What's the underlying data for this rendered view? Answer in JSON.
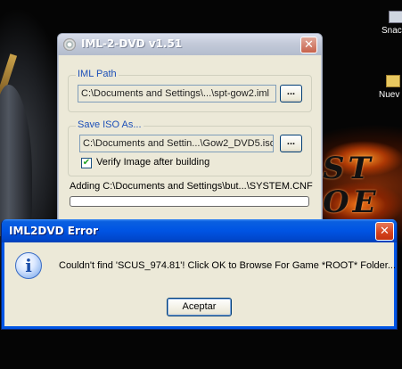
{
  "desktop": {
    "icons": [
      {
        "label": "Snac",
        "icon": "shortcut-icon"
      },
      {
        "label": "Nuev",
        "icon": "folder-icon"
      }
    ],
    "wallpaper_logo": "ST\nOE"
  },
  "main_window": {
    "title": "IML-2-DVD v1.51",
    "iml_group": {
      "legend": "IML Path",
      "path_value": "C:\\Documents and Settings\\...\\spt-gow2.iml",
      "browse_label": "..."
    },
    "iso_group": {
      "legend": "Save ISO As...",
      "path_value": "C:\\Documents and Settin...\\Gow2_DVD5.iso",
      "browse_label": "...",
      "verify_label": "Verify Image after building",
      "verify_checked": true
    },
    "status_text": "Adding C:\\Documents and Settings\\but...\\SYSTEM.CNF",
    "progress": 0
  },
  "error_dialog": {
    "title": "IML2DVD Error",
    "message": "Couldn't find 'SCUS_974.81'! Click OK to Browse For Game *ROOT* Folder...",
    "ok_label": "Aceptar",
    "icon": "info-icon"
  },
  "colors": {
    "xp_title_blue": "#0054e3",
    "dialog_face": "#ece9d8",
    "group_legend": "#1c4fb8",
    "close_red": "#d4411c"
  }
}
